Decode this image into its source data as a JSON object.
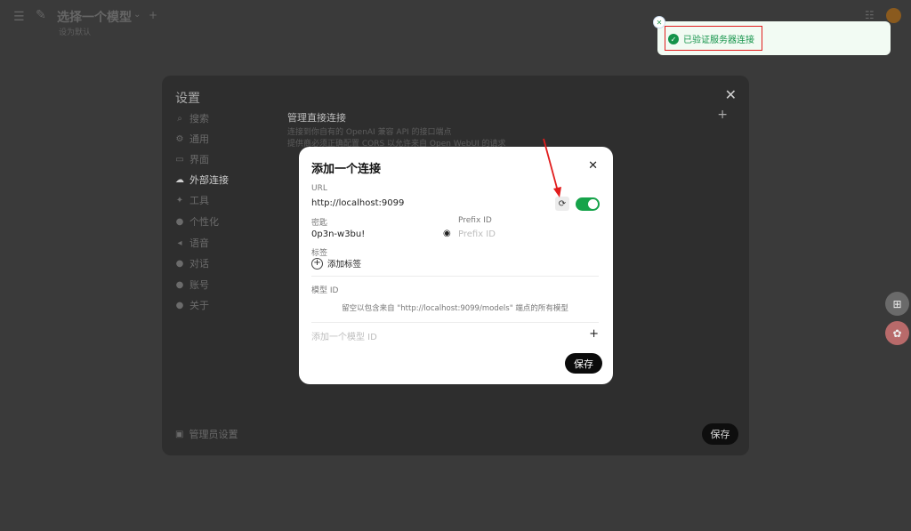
{
  "topbar": {
    "model_title": "选择一个模型",
    "model_subtitle": "设为默认"
  },
  "settings": {
    "title": "设置",
    "nav": [
      {
        "label": "搜索",
        "icon": "search-icon"
      },
      {
        "label": "通用",
        "icon": "gear-icon"
      },
      {
        "label": "界面",
        "icon": "monitor-icon"
      },
      {
        "label": "外部连接",
        "icon": "cloud-icon",
        "active": true
      },
      {
        "label": "工具",
        "icon": "wrench-icon"
      },
      {
        "label": "个性化",
        "icon": "user-icon"
      },
      {
        "label": "语音",
        "icon": "speaker-icon"
      },
      {
        "label": "对话",
        "icon": "chat-icon"
      },
      {
        "label": "账号",
        "icon": "account-icon"
      },
      {
        "label": "关于",
        "icon": "info-icon"
      }
    ],
    "section_title": "管理直接连接",
    "section_desc_1": "连接到你自有的 OpenAI 兼容 API 的接口端点",
    "section_desc_2": "提供商必须正确配置 CORS 以允许来自 Open WebUI 的请求",
    "admin_settings": "管理员设置",
    "save_label": "保存"
  },
  "toast": {
    "message": "已验证服务器连接",
    "status_color": "#14934a"
  },
  "modal": {
    "title": "添加一个连接",
    "url_label": "URL",
    "url_value": "http://localhost:9099",
    "enabled": true,
    "key_label": "密匙",
    "key_value": "0p3n-w3bu!",
    "prefix_label": "Prefix ID",
    "prefix_placeholder": "Prefix ID",
    "tags_label": "标签",
    "add_tag_label": "添加标签",
    "model_id_label": "模型 ID",
    "model_hint": "留空以包含来自 \"http://localhost:9099/models\" 端点的所有模型",
    "add_model_placeholder": "添加一个模型 ID",
    "save_label": "保存"
  },
  "accent_color": "#16a34a",
  "annotation_color": "#e11d1d"
}
